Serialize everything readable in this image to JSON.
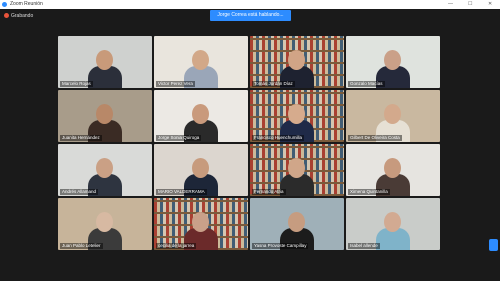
{
  "window": {
    "title": "Zoom Reunión",
    "minimize": "—",
    "maximize": "☐",
    "close": "✕"
  },
  "recording": {
    "label": "Grabando"
  },
  "speaking_banner": "Jorge Correa está hablando...",
  "participants": [
    {
      "name": "Marcelo Rojas",
      "bg": "#cfd1cf",
      "skin": "#c89a7a",
      "clothes": "#2b2f3a",
      "shelf": false
    },
    {
      "name": "Victor Perez Vera",
      "bg": "#e9e5dd",
      "skin": "#d2a888",
      "clothes": "#9aa6b8",
      "shelf": false
    },
    {
      "name": "Tomás Jordán Díaz",
      "bg": "#8c6a48",
      "skin": "#d1a486",
      "clothes": "#1e2230",
      "shelf": true
    },
    {
      "name": "Gonzalo Macías",
      "bg": "#dfe3de",
      "skin": "#caa088",
      "clothes": "#25293a",
      "shelf": false
    },
    {
      "name": "Juanita Hernández",
      "bg": "#a89c8a",
      "skin": "#b88868",
      "clothes": "#3a2b24",
      "shelf": false
    },
    {
      "name": "Jorge Sonia Quiroga",
      "bg": "#ece9e4",
      "skin": "#c99a7c",
      "clothes": "#2a2a2a",
      "shelf": false
    },
    {
      "name": "Francisco Huenchumilla",
      "bg": "#8a6548",
      "skin": "#d6ab8d",
      "clothes": "#1f2a48",
      "shelf": true
    },
    {
      "name": "Gilbert De Oliveira Costa",
      "bg": "#c9b8a0",
      "skin": "#d3a98c",
      "clothes": "#e6e0d4",
      "shelf": false
    },
    {
      "name": "Andrés Allamand",
      "bg": "#d9dad8",
      "skin": "#caa085",
      "clothes": "#2e3440",
      "shelf": false
    },
    {
      "name": "MARIO VALDERRAMA",
      "bg": "#dcd6cf",
      "skin": "#c79b7d",
      "clothes": "#1d2638",
      "shelf": false
    },
    {
      "name": "Fernando Atria",
      "bg": "#7d5f42",
      "skin": "#d0a689",
      "clothes": "#2b2b2b",
      "shelf": true
    },
    {
      "name": "Ximena Quintanilla",
      "bg": "#e6e4e0",
      "skin": "#c79a7e",
      "clothes": "#4a3b36",
      "shelf": false
    },
    {
      "name": "Juan Pablo Letelier",
      "bg": "#c7b49a",
      "skin": "#d7b9a2",
      "clothes": "#3b3b3b",
      "shelf": false
    },
    {
      "name": "cecilia de la jarrea",
      "bg": "#86684c",
      "skin": "#c9a089",
      "clothes": "#6b2a2a",
      "shelf": true
    },
    {
      "name": "Yasna Provoste Campillay",
      "bg": "#9fb0b8",
      "skin": "#c69c80",
      "clothes": "#1c1c1c",
      "shelf": false
    },
    {
      "name": "Isabel allende",
      "bg": "#c9ccc9",
      "skin": "#d2aa92",
      "clothes": "#7fb3c9",
      "shelf": false
    }
  ]
}
